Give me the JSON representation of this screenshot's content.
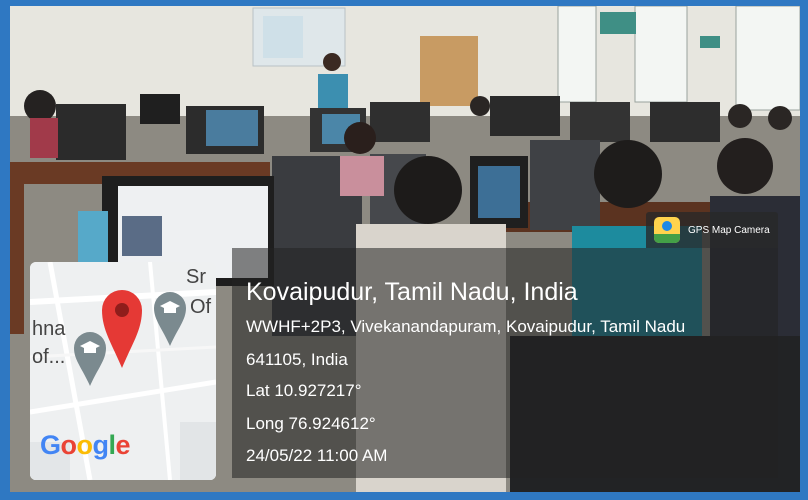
{
  "badge": {
    "label": "GPS Map Camera",
    "icon": "gps-map-camera-icon"
  },
  "location": {
    "title": "Kovaipudur, Tamil Nadu, India",
    "address_line1": "WWHF+2P3, Vivekanandapuram, Kovaipudur, Tamil Nadu",
    "address_line2": "641105, India",
    "latitude": "Lat 10.927217°",
    "longitude": "Long 76.924612°",
    "datetime": "24/05/22 11:00 AM"
  },
  "map": {
    "labels": {
      "top_right": "Sr",
      "right": "Of",
      "left_top": "hna",
      "left_bottom": "of..."
    },
    "logo": "Google",
    "icons": [
      "map-pin-icon",
      "education-pin-icon",
      "education-pin-icon"
    ]
  },
  "colors": {
    "frame": "#2f78c2",
    "pin": "#e53935",
    "edu_pin": "#7b8a8f"
  }
}
